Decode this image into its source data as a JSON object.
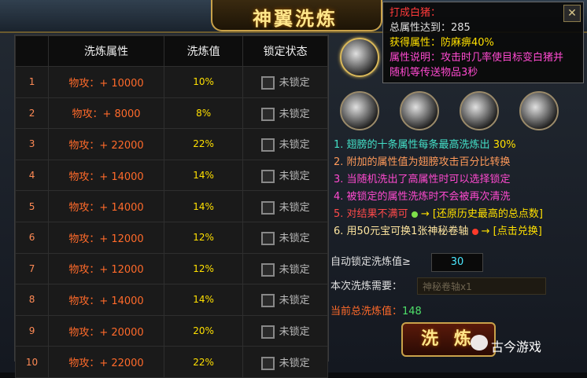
{
  "window": {
    "title": "神翼洗炼",
    "close_label": "✕"
  },
  "table": {
    "headers": [
      "",
      "洗炼属性",
      "洗炼值",
      "锁定状态"
    ],
    "rows": [
      {
        "idx": "1",
        "attr": "物攻：+ 10000",
        "val": "10%",
        "lock": "未锁定"
      },
      {
        "idx": "2",
        "attr": "物攻：+ 8000",
        "val": "8%",
        "lock": "未锁定"
      },
      {
        "idx": "3",
        "attr": "物攻：+ 22000",
        "val": "22%",
        "lock": "未锁定"
      },
      {
        "idx": "4",
        "attr": "物攻：+ 14000",
        "val": "14%",
        "lock": "未锁定"
      },
      {
        "idx": "5",
        "attr": "物攻：+ 14000",
        "val": "14%",
        "lock": "未锁定"
      },
      {
        "idx": "6",
        "attr": "物攻：+ 12000",
        "val": "12%",
        "lock": "未锁定"
      },
      {
        "idx": "7",
        "attr": "物攻：+ 12000",
        "val": "12%",
        "lock": "未锁定"
      },
      {
        "idx": "8",
        "attr": "物攻：+ 14000",
        "val": "14%",
        "lock": "未锁定"
      },
      {
        "idx": "9",
        "attr": "物攻：+ 20000",
        "val": "20%",
        "lock": "未锁定"
      },
      {
        "idx": "10",
        "attr": "物攻：+ 22000",
        "val": "22%",
        "lock": "未锁定"
      }
    ]
  },
  "tooltip": {
    "title": "打成白猪：",
    "total": "总属性达到：285",
    "gain": "获得属性：防麻痹40%",
    "desc1": "属性说明：攻击时几率使目标变白猪并",
    "desc2": "随机等传送物品3秒"
  },
  "tips": {
    "t1a": "1. 翅膀的十条属性每条最高洗炼出",
    "t1b": "30%",
    "t2": "2. 附加的属性值为翅膀攻击百分比转换",
    "t3": "3. 当随机洗出了高属性时可以选择锁定",
    "t4": "4. 被锁定的属性洗炼时不会被再次清洗",
    "t5a": "5. 对结果不满可",
    "t5b": "→ [还原历史最高的总点数]",
    "t6a": "6. 用50元宝可换1张神秘卷轴",
    "t6b": "→ [点击兑换]"
  },
  "auto_lock": {
    "label": "自动锁定洗炼值≥",
    "value": "30"
  },
  "need": {
    "label": "本次洗炼需要：",
    "value": "神秘卷轴x1"
  },
  "total": {
    "label": "当前总洗炼值：",
    "value": "148"
  },
  "wash_button": "洗 炼",
  "watermark": "古今游戏",
  "colors": {
    "gold": "#c9a24a",
    "value_yellow": "#ffe000",
    "attr_orange": "#ff6a2a"
  }
}
